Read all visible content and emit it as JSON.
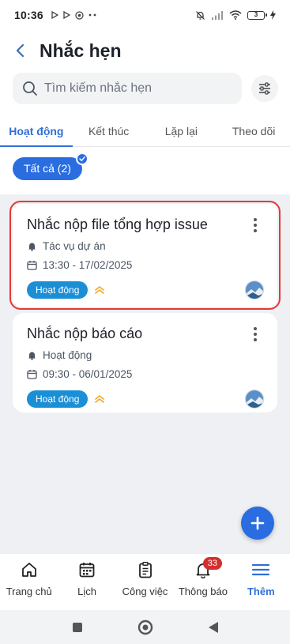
{
  "status_bar": {
    "time": "10:36",
    "battery": "3"
  },
  "header": {
    "title": "Nhắc hẹn"
  },
  "search": {
    "placeholder": "Tìm kiếm nhắc hẹn"
  },
  "tabs": [
    {
      "label": "Hoạt động",
      "active": true
    },
    {
      "label": "Kết thúc"
    },
    {
      "label": "Lặp lại"
    },
    {
      "label": "Theo dõi"
    }
  ],
  "filter_chip": {
    "label": "Tất cả (2)"
  },
  "reminders": [
    {
      "title": "Nhắc nộp file tổng hợp issue",
      "category": "Tác vụ dự án",
      "datetime": "13:30 - 17/02/2025",
      "status": "Hoạt động"
    },
    {
      "title": "Nhắc nộp báo cáo",
      "category": "Hoạt động",
      "datetime": "09:30 - 06/01/2025",
      "status": "Hoạt động"
    }
  ],
  "bottom_nav": [
    {
      "label": "Trang chủ",
      "icon": "home-icon"
    },
    {
      "label": "Lịch",
      "icon": "calendar-icon"
    },
    {
      "label": "Công việc",
      "icon": "clipboard-icon"
    },
    {
      "label": "Thông báo",
      "icon": "bell-icon",
      "badge": "33"
    },
    {
      "label": "Thêm",
      "icon": "menu-icon",
      "active": true
    }
  ],
  "colors": {
    "accent": "#2a6de0",
    "status_badge": "#1b8fd6",
    "highlight_outline": "#e53935",
    "priority": "#f5a623"
  }
}
